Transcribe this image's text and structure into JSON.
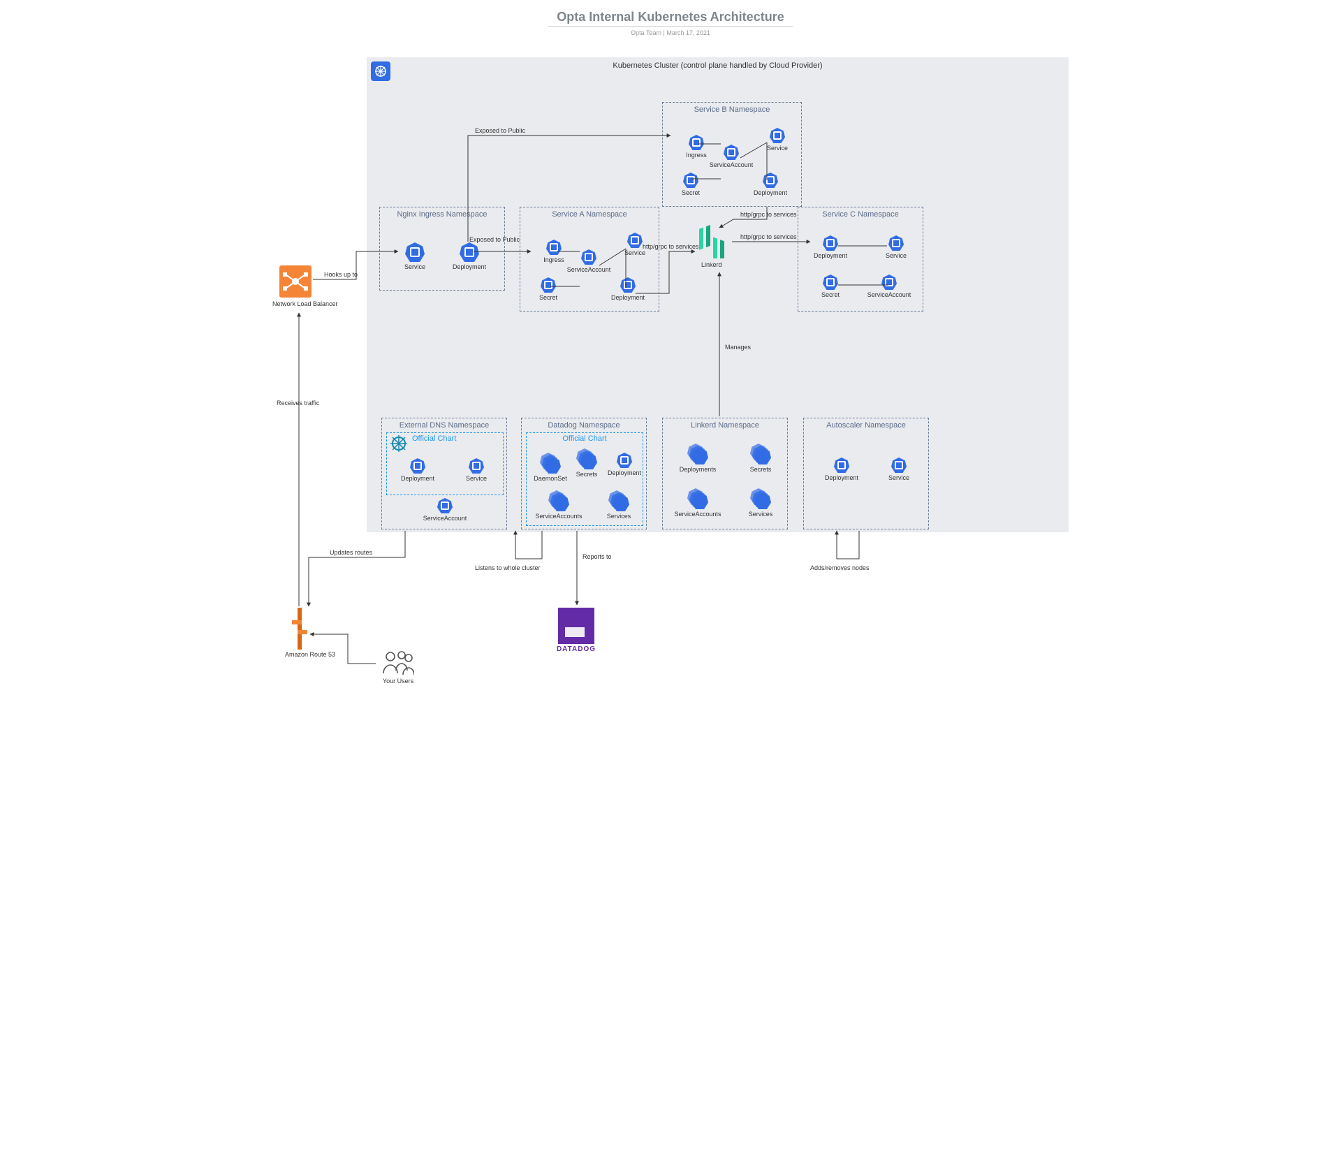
{
  "header": {
    "title": "Opta Internal Kubernetes Architecture",
    "subtitle": "Opta Team  |  March 17, 2021"
  },
  "cluster": {
    "title": "Kubernetes Cluster (control plane handled by Cloud Provider)"
  },
  "ns": {
    "nginx": {
      "title": "Nginx Ingress Namespace",
      "service": "Service",
      "deployment": "Deployment"
    },
    "svcA": {
      "title": "Service A Namespace",
      "ingress": "Ingress",
      "svcacct": "ServiceAccount",
      "secret": "Secret",
      "service": "Service",
      "deployment": "Deployment"
    },
    "svcB": {
      "title": "Service B Namespace",
      "ingress": "Ingress",
      "svcacct": "ServiceAccount",
      "secret": "Secret",
      "service": "Service",
      "deployment": "Deployment"
    },
    "svcC": {
      "title": "Service C Namespace",
      "deployment": "Deployment",
      "service": "Service",
      "secret": "Secret",
      "svcacct": "ServiceAccount"
    },
    "extdns": {
      "title": "External DNS Namespace",
      "chart": "Official Chart",
      "deployment": "Deployment",
      "service": "Service",
      "svcacct": "ServiceAccount"
    },
    "datadog": {
      "title": "Datadog Namespace",
      "chart": "Official Chart",
      "daemonset": "DaemonSet",
      "secrets": "Secrets",
      "deployment": "Deployment",
      "svcaccts": "ServiceAccounts",
      "services": "Services"
    },
    "linkerd": {
      "title": "Linkerd Namespace",
      "deployments": "Deployments",
      "secrets": "Secrets",
      "svcaccts": "ServiceAccounts",
      "services": "Services"
    },
    "auto": {
      "title": "Autoscaler Namespace",
      "deployment": "Deployment",
      "service": "Service"
    }
  },
  "labels": {
    "linkerd": "Linkerd",
    "nlb": "Network Load Balancer",
    "r53": "Amazon Route 53",
    "users": "Your Users",
    "datadog": "DATADOG"
  },
  "edges": {
    "hooks": "Hooks up to",
    "exposedA": "Exposed to Public",
    "exposedB": "Exposed to Public",
    "httpA": "http/grpc to services",
    "httpB": "http/grpc to services",
    "httpC": "http/grpc to services",
    "manages": "Manages",
    "receives": "Receives traffic",
    "updates": "Updates routes",
    "listens": "Listens to whole cluster",
    "reports": "Reports to",
    "adds": "Adds/removes nodes"
  }
}
